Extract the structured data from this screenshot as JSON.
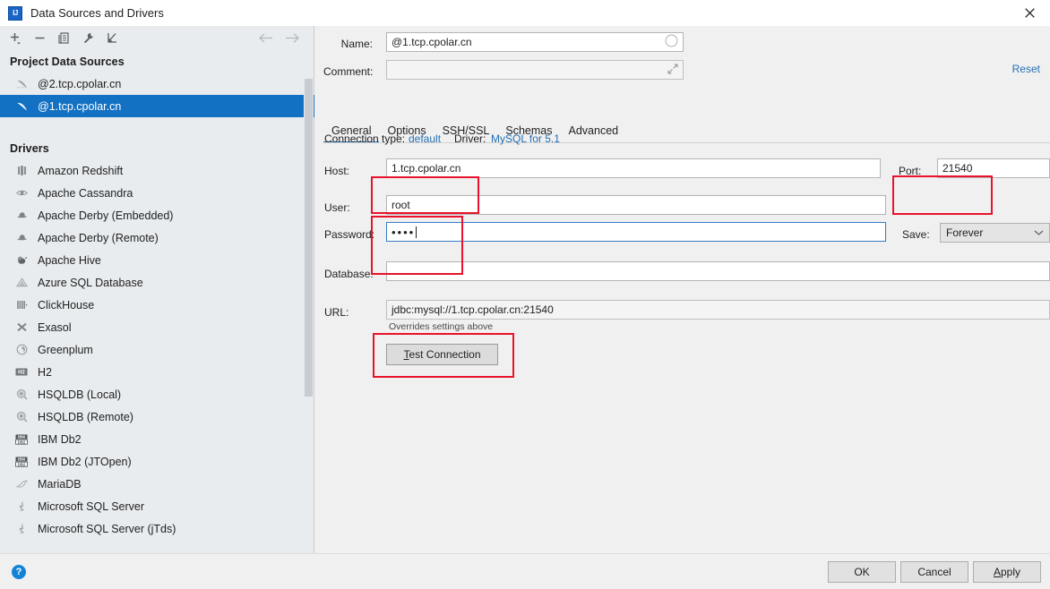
{
  "window": {
    "title": "Data Sources and Drivers",
    "logo_text": "IJ",
    "close_icon": "close-icon"
  },
  "toolbar": {
    "add_label": "+",
    "remove_label": "−",
    "copy_icon": "copy-icon",
    "wrench_icon": "wrench-icon",
    "import_icon": "import-arrow-icon",
    "back_icon": "arrow-left-icon",
    "forward_icon": "arrow-right-icon"
  },
  "sidebar": {
    "project_header": "Project Data Sources",
    "data_sources": [
      {
        "label": "@2.tcp.cpolar.cn",
        "selected": false,
        "icon": "mysql-dolphin-icon"
      },
      {
        "label": "@1.tcp.cpolar.cn",
        "selected": true,
        "icon": "mysql-dolphin-icon"
      }
    ],
    "drivers_header": "Drivers",
    "drivers": [
      {
        "label": "Amazon Redshift",
        "icon": "redshift-icon"
      },
      {
        "label": "Apache Cassandra",
        "icon": "cassandra-eye-icon"
      },
      {
        "label": "Apache Derby (Embedded)",
        "icon": "derby-hat-icon"
      },
      {
        "label": "Apache Derby (Remote)",
        "icon": "derby-hat-icon"
      },
      {
        "label": "Apache Hive",
        "icon": "hive-bee-icon"
      },
      {
        "label": "Azure SQL Database",
        "icon": "azure-triangle-icon"
      },
      {
        "label": "ClickHouse",
        "icon": "clickhouse-bars-icon"
      },
      {
        "label": "Exasol",
        "icon": "exasol-x-icon"
      },
      {
        "label": "Greenplum",
        "icon": "greenplum-circle-icon"
      },
      {
        "label": "H2",
        "icon": "h2-icon"
      },
      {
        "label": "HSQLDB (Local)",
        "icon": "hsqldb-icon"
      },
      {
        "label": "HSQLDB (Remote)",
        "icon": "hsqldb-icon"
      },
      {
        "label": "IBM Db2",
        "icon": "ibm-db2-icon"
      },
      {
        "label": "IBM Db2 (JTOpen)",
        "icon": "ibm-db2-icon"
      },
      {
        "label": "MariaDB",
        "icon": "mariadb-seal-icon"
      },
      {
        "label": "Microsoft SQL Server",
        "icon": "mssql-icon"
      },
      {
        "label": "Microsoft SQL Server (jTds)",
        "icon": "mssql-icon"
      }
    ]
  },
  "form": {
    "name_label": "Name:",
    "name_value": "@1.tcp.cpolar.cn",
    "name_indicator_icon": "circle-outline-icon",
    "comment_label": "Comment:",
    "comment_value": "",
    "comment_expand_icon": "expand-arrows-icon",
    "reset_label": "Reset",
    "tabs": [
      {
        "label": "General",
        "active": true
      },
      {
        "label": "Options",
        "active": false
      },
      {
        "label": "SSH/SSL",
        "active": false
      },
      {
        "label": "Schemas",
        "active": false
      },
      {
        "label": "Advanced",
        "active": false
      }
    ],
    "connection_type_label": "Connection type:",
    "connection_type_value": "default",
    "driver_label": "Driver:",
    "driver_value": "MySQL for 5.1",
    "host_label": "Host:",
    "host_value": "1.tcp.cpolar.cn",
    "port_label": "Port:",
    "port_value": "21540",
    "user_label": "User:",
    "user_value": "root",
    "password_label": "Password:",
    "password_value": "••••",
    "save_label": "Save:",
    "save_value": "Forever",
    "save_chevron_icon": "chevron-down-icon",
    "database_label": "Database:",
    "database_value": "",
    "url_label": "URL:",
    "url_value": "jdbc:mysql://1.tcp.cpolar.cn:21540",
    "url_hint": "Overrides settings above",
    "test_connection_label": "Test Connection",
    "test_connection_mnemonic": "T"
  },
  "footer": {
    "help_icon": "help-icon",
    "help_label": "?",
    "ok_label": "OK",
    "cancel_label": "Cancel",
    "apply_label": "Apply",
    "apply_mnemonic": "A"
  },
  "annotations": {
    "accent_red": "#e8132b",
    "boxes": [
      {
        "name": "host-highlight"
      },
      {
        "name": "port-highlight"
      },
      {
        "name": "user-password-highlight"
      },
      {
        "name": "test-connection-highlight"
      }
    ]
  },
  "colors": {
    "selection_blue": "#1371c3",
    "link_blue": "#2470b3",
    "tab_underline": "#2a7bc8",
    "focus_blue": "#3a7cc4",
    "sidebar_bg": "#e8ecef",
    "panel_bg": "#f0f0f0"
  }
}
